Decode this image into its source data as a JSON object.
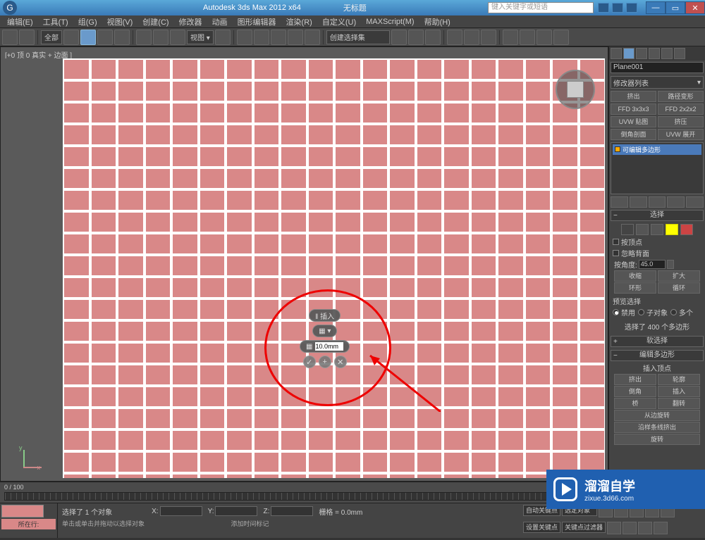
{
  "title": "Autodesk 3ds Max 2012 x64",
  "untitled": "无标题",
  "search_placeholder": "键入关键字或短语",
  "menu": [
    "编辑(E)",
    "工具(T)",
    "组(G)",
    "视图(V)",
    "创建(C)",
    "修改器",
    "动画",
    "图形编辑器",
    "渲染(R)",
    "自定义(U)",
    "MAXScript(M)",
    "帮助(H)"
  ],
  "toolbar": {
    "selset_label": "创建选择集",
    "all_label": "全部"
  },
  "viewport": {
    "label": "[+0 顶 0 真实 + 边面 ]",
    "axis_x": "x",
    "axis_y": "y"
  },
  "float": {
    "title": "‖ 插入",
    "value": "10.0mm",
    "ok": "✓",
    "plus": "+",
    "cancel": "✕"
  },
  "rpanel": {
    "obj_name": "Plane001",
    "mod_list": "修改器列表",
    "btn_rows": [
      [
        "挤出",
        "路径变形"
      ],
      [
        "FFD 3x3x3",
        "FFD 2x2x2"
      ],
      [
        "UVW 贴图",
        "挤压"
      ],
      [
        "倒角剖面",
        "UVW 展开"
      ]
    ],
    "stack_item": "可编辑多边形",
    "sections": {
      "select": "选择",
      "soft": "软选择",
      "editpoly": "编辑多边形",
      "insvert": "插入顶点"
    },
    "sel": {
      "byvert": "按顶点",
      "ignoreback": "忽略背面",
      "byangle": "按角度:",
      "byangle_val": "45.0",
      "shrink": "收缩",
      "grow": "扩大",
      "ring": "环形",
      "loop": "循环",
      "preview": "预览选择",
      "disable": "禁用",
      "subobj": "子对象",
      "multi": "多个",
      "count": "选择了 400 个多边形"
    },
    "editpoly_btns": [
      [
        "挤出",
        "轮廓"
      ],
      [
        "倒角",
        "插入"
      ],
      [
        "桥",
        "翻转"
      ]
    ],
    "edgerot": "从边旋转",
    "splineext": "沿样条线挤出",
    "rot": "旋转"
  },
  "timeline": {
    "range": "0 / 100"
  },
  "status": {
    "current_row": "所在行:",
    "sel_text": "选择了 1 个对象",
    "hint": "单击或单击并拖动以选择对象",
    "x": "X:",
    "y": "Y:",
    "z": "Z:",
    "grid": "栅格 = 0.0mm",
    "addtime": "添加时间标记",
    "autokey": "自动关键点",
    "selset": "选定对象",
    "setkey": "设置关键点",
    "keyfilter": "关键点过滤器"
  },
  "watermark": {
    "big": "溜溜自学",
    "small": "zixue.3d66.com"
  }
}
